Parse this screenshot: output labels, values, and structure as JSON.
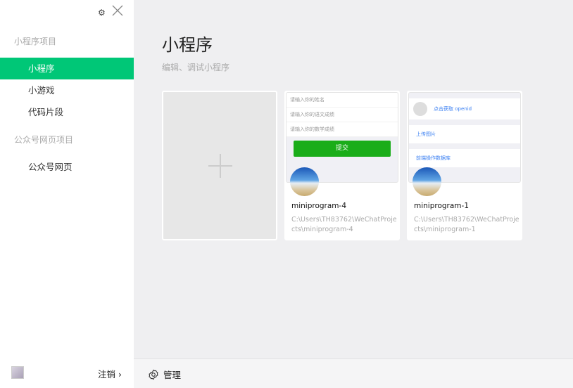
{
  "sidebar": {
    "section_mini": "小程序项目",
    "items": [
      "小程序",
      "小游戏",
      "代码片段"
    ],
    "section_web": "公众号网页项目",
    "web_items": [
      "公众号网页"
    ],
    "logout": "注销",
    "logout_arrow": "›"
  },
  "main": {
    "title": "小程序",
    "subtitle": "编辑、调试小程序"
  },
  "projects": [
    {
      "name": "miniprogram-4",
      "path": "C:\\Users\\TH83762\\WeChatProjects\\miniprogram-4",
      "preview": {
        "fields": [
          "请输入你的姓名",
          "请输入你的语文成绩",
          "请输入你的数学成绩"
        ],
        "button": "提交"
      }
    },
    {
      "name": "miniprogram-1",
      "path": "C:\\Users\\TH83762\\WeChatProjects\\miniprogram-1",
      "preview": {
        "openid": "点击获取 openid",
        "upload": "上传图片",
        "db": "前端操作数据库"
      }
    }
  ],
  "footer": {
    "manage": "管理"
  },
  "colors": {
    "accent": "#00c777",
    "button": "#1aad19"
  }
}
